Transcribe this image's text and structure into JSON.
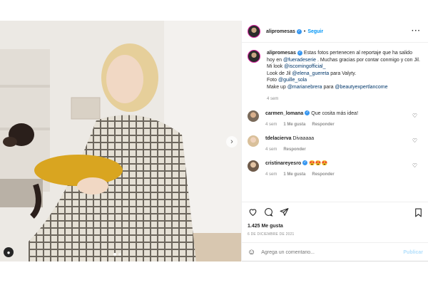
{
  "post": {
    "author": "alipromesas",
    "follow_label": "Seguir",
    "separator": "•",
    "more_label": "···",
    "caption": {
      "line1": "Estas fotos pertenecen al reportaje que ha salido hoy en",
      "mention1": "@fueradeserie",
      "line2": ". Muchas gracias por contar conmigo y con Jil.",
      "look_label": "Mi look",
      "mention2": "@iscomingofficial_",
      "jil_label": "Look de Jil",
      "mention3": "@elena_guereta",
      "para_valyty": "para Valyty.",
      "foto_label": "Foto",
      "mention4": "@guille_sola",
      "makeup_label": "Make up",
      "mention5": "@marianebrera",
      "para": "para",
      "mention6": "@beautyexpertlancome",
      "time": "4 sem"
    },
    "comments": [
      {
        "user": "carmen_lomana",
        "verified": true,
        "text": "Que cosita más idea!",
        "time": "4 sem",
        "likes": "1 Me gusta",
        "reply": "Responder"
      },
      {
        "user": "tdelacierva",
        "verified": false,
        "text": "Divaaaaa",
        "time": "4 sem",
        "likes": "",
        "reply": "Responder"
      },
      {
        "user": "cristinareyesro",
        "verified": true,
        "text": "😍😍😍",
        "time": "4 sem",
        "likes": "1 Me gusta",
        "reply": "Responder"
      }
    ],
    "likes": "1.425 Me gusta",
    "date": "6 DE DICIEMBRE DE 2021",
    "comment_placeholder": "Agrega un comentario...",
    "publish_label": "Publicar",
    "carousel": {
      "total": 2,
      "active": 1
    }
  },
  "icons": {
    "heart": "heart-icon",
    "comment": "comment-icon",
    "share": "share-icon",
    "save": "bookmark-icon",
    "emoji": "emoji-icon",
    "next": "chevron-right-icon",
    "user_tag": "user-tag-icon"
  },
  "colors": {
    "link": "#00376b",
    "follow": "#0095f6",
    "verified": "#3897f0",
    "muted": "#8e8e8e",
    "publish_disabled": "#b2dffc"
  }
}
